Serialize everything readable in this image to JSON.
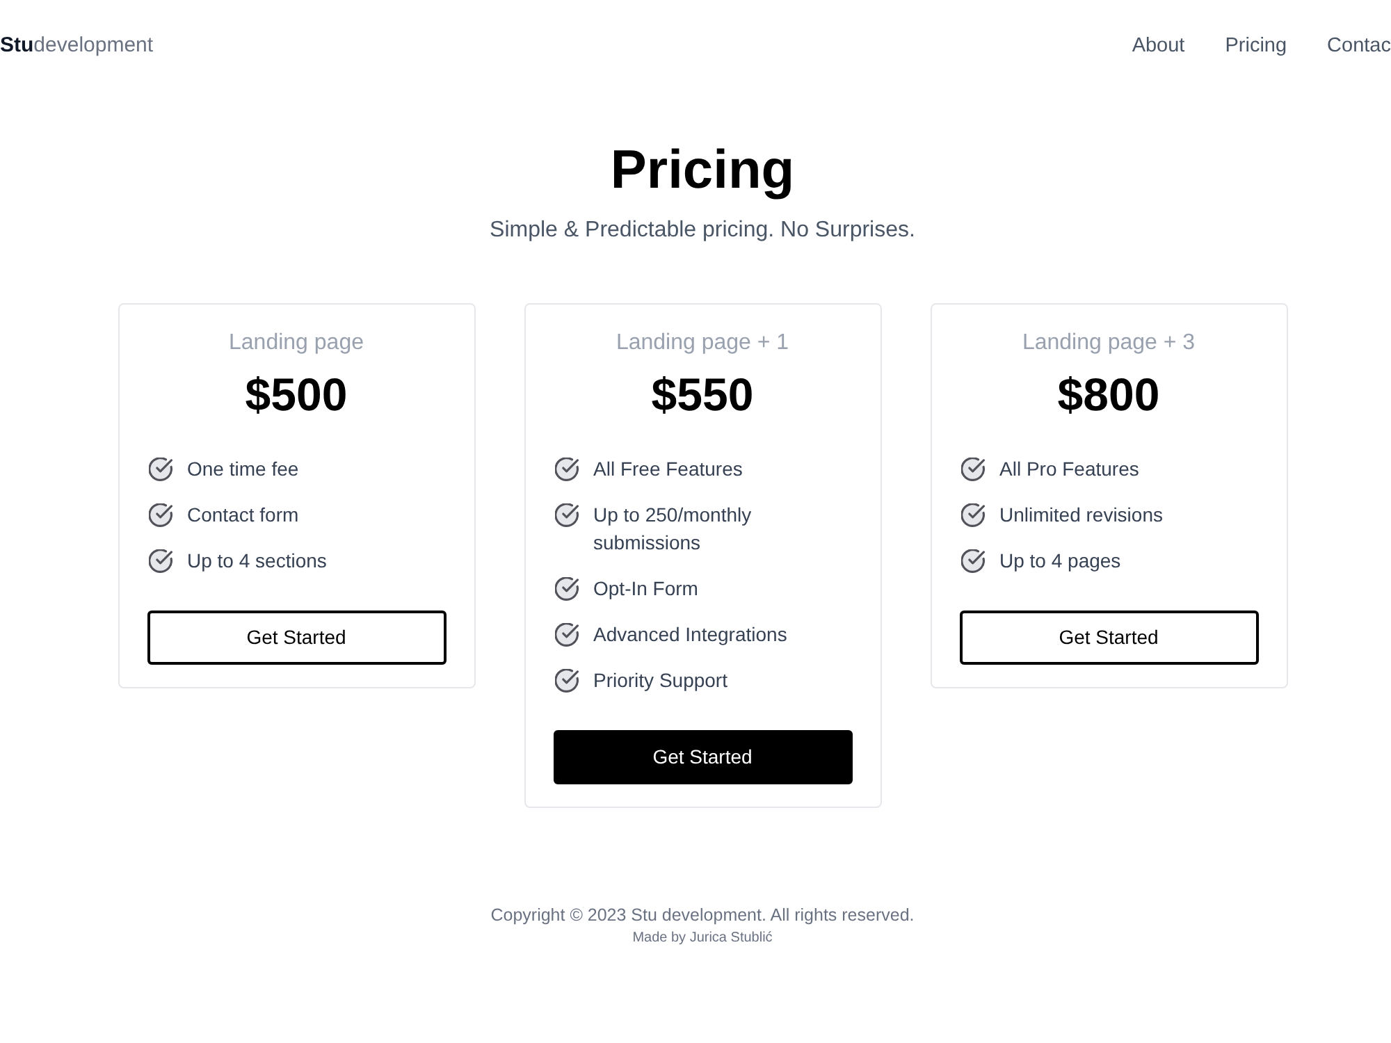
{
  "header": {
    "logo": {
      "bold": "Stu",
      "light": "development"
    },
    "nav": [
      {
        "label": "About"
      },
      {
        "label": "Pricing"
      },
      {
        "label": "Contac"
      }
    ]
  },
  "hero": {
    "title": "Pricing",
    "subtitle": "Simple & Predictable pricing. No Surprises."
  },
  "plans": [
    {
      "name": "Landing page",
      "price": "$500",
      "highlighted": false,
      "features": [
        "One time fee",
        "Contact form",
        "Up to 4 sections"
      ],
      "button": "Get Started"
    },
    {
      "name": "Landing page + 1",
      "price": "$550",
      "highlighted": true,
      "features": [
        "All Free Features",
        "Up to 250/monthly submissions",
        "Opt-In Form",
        "Advanced Integrations",
        "Priority Support"
      ],
      "button": "Get Started"
    },
    {
      "name": "Landing page + 3",
      "price": "$800",
      "highlighted": false,
      "features": [
        "All Pro Features",
        "Unlimited revisions",
        "Up to 4 pages"
      ],
      "button": "Get Started"
    }
  ],
  "footer": {
    "copyright": "Copyright © 2023 Stu development. All rights reserved.",
    "credit": "Made by Jurica Stublić"
  }
}
